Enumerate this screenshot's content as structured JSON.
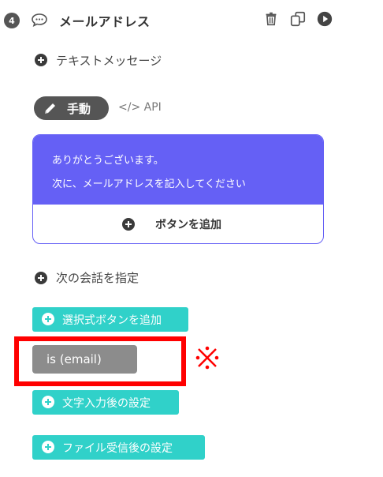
{
  "step": {
    "number": "4",
    "title": "メールアドレス",
    "icons": [
      "chat-bubble-icon",
      "trash-icon",
      "copy-icon",
      "play-icon"
    ]
  },
  "text_message_label": "テキストメッセージ",
  "mode": {
    "manual_label": "手動",
    "api_label": "</> API"
  },
  "message": {
    "lines": [
      "ありがとうございます。",
      "次に、メールアドレスを記入してください"
    ],
    "add_button_label": "ボタンを追加"
  },
  "next_conversation_label": "次の会話を指定",
  "buttons": {
    "add_choice": "選択式ボタンを追加",
    "after_text_input": "文字入力後の設定",
    "after_file_upload": "ファイル受信後の設定"
  },
  "condition": {
    "label": "is (email)"
  },
  "annotation_mark": "※",
  "colors": {
    "accent_purple": "#6560f5",
    "teal": "#30d1c9",
    "highlight_red": "#ff0000",
    "badge_dark": "#555555"
  }
}
